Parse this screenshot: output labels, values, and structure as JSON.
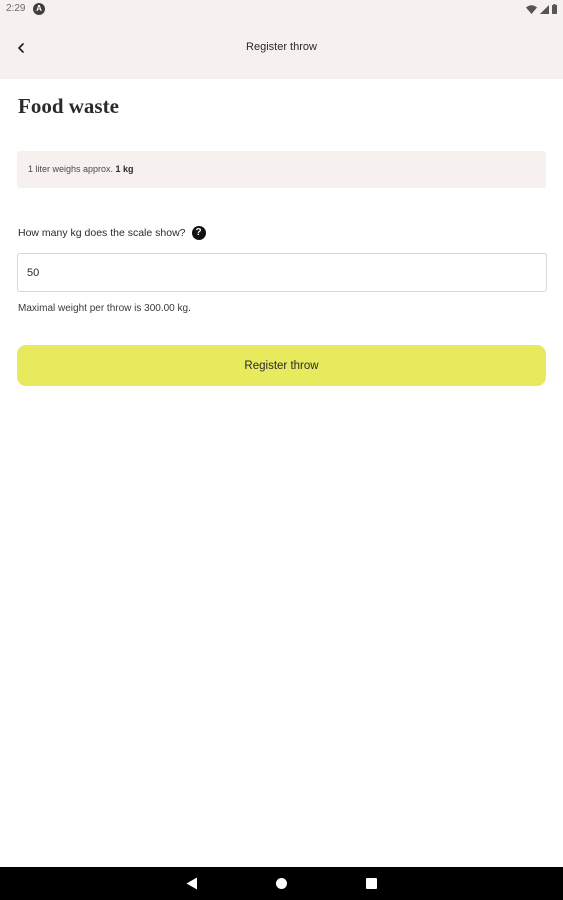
{
  "status_bar": {
    "time": "2:29",
    "app_icon_letter": "A",
    "icons": [
      "wifi-icon",
      "signal-icon",
      "battery-icon"
    ]
  },
  "app_bar": {
    "back_icon": "chevron-left-icon",
    "title": "Register throw"
  },
  "page": {
    "title": "Food waste",
    "info_prefix": "1 liter weighs approx. ",
    "info_value": "1 kg",
    "question": "How many kg does the scale show?",
    "help_icon": "help-icon",
    "input_value": "50",
    "max_weight_note": "Maximal weight per throw is 300.00 kg.",
    "button_label": "Register throw"
  },
  "colors": {
    "header_bg": "#f6f1ef",
    "button_bg": "#e7ea5c",
    "info_bg": "#f6f1ef",
    "nav_bar_bg": "#000000"
  },
  "nav_bar": {
    "icons": [
      "nav-back-icon",
      "nav-home-icon",
      "nav-recents-icon"
    ]
  }
}
